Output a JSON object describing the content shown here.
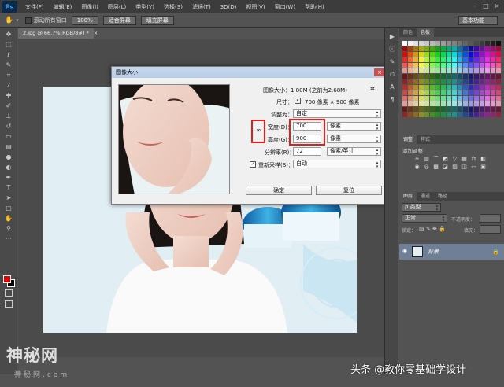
{
  "app": {
    "logo": "Ps"
  },
  "menu": [
    "文件(F)",
    "编辑(E)",
    "图像(I)",
    "图层(L)",
    "类型(Y)",
    "选择(S)",
    "滤镜(T)",
    "3D(D)",
    "视图(V)",
    "窗口(W)",
    "帮助(H)"
  ],
  "options": {
    "scroll_all_label": "滚动所有窗口",
    "zoom_value": "100%",
    "fit_screen": "适合屏幕",
    "fill_screen": "填充屏幕",
    "workspace": "基本功能"
  },
  "document": {
    "tab_title": "2.jpg @ 66.7%(RGB/8#) *",
    "close": "×"
  },
  "dialog": {
    "title": "图像大小",
    "image_size": "图像大小：1.80M (之前为2.68M)",
    "dimensions_label": "尺寸：",
    "dimensions_value": "700 像素 × 900 像素",
    "fit_to_label": "调整为：",
    "fit_to_value": "自定",
    "width_label": "宽度(D)：",
    "width_value": "700",
    "width_unit": "像素",
    "height_label": "高度(G)：",
    "height_value": "900",
    "height_unit": "像素",
    "resolution_label": "分辨率(R)：",
    "resolution_value": "72",
    "resolution_unit": "像素/英寸",
    "resample_label": "重新采样(S)：",
    "resample_value": "自动",
    "ok": "确定",
    "cancel": "复位",
    "close": "×"
  },
  "panels": {
    "color_tabs": [
      "颜色",
      "色板"
    ],
    "adjust_tabs": [
      "调整",
      "样式"
    ],
    "adjust_title": "添加调整",
    "layer_tabs": [
      "图层",
      "通道",
      "路径"
    ],
    "kind_label": "ρ 类型",
    "blend_mode": "正常",
    "opacity_label": "不透明度：",
    "lock_label": "锁定：",
    "fill_label": "填充：",
    "layer_name": "背景"
  },
  "watermark": {
    "main": "神秘网",
    "sub": "神秘网.com",
    "toutiao": "头条 @教你零基础学设计"
  },
  "colors": {
    "accent_red": "#e02020",
    "layer_highlight": "#6f7f96"
  }
}
